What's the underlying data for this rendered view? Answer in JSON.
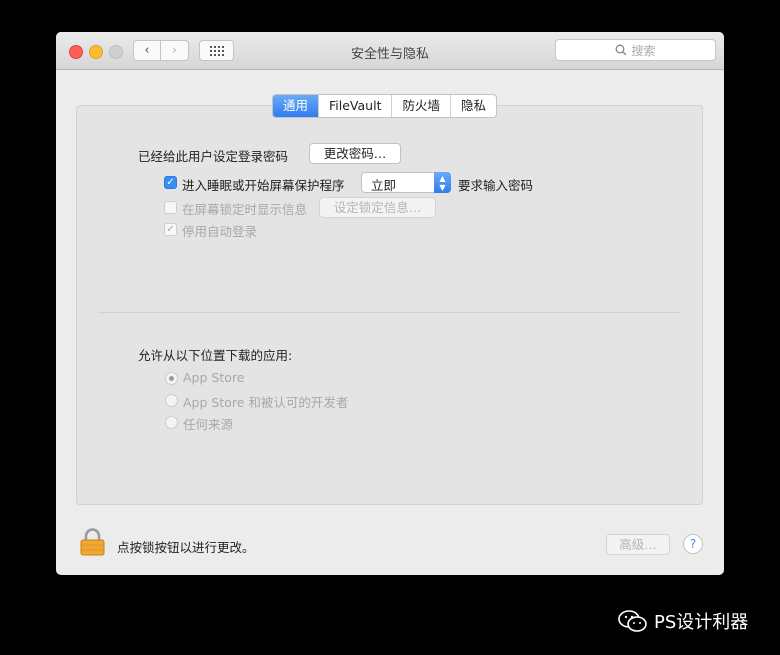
{
  "window": {
    "title": "安全性与隐私"
  },
  "search": {
    "placeholder": "搜索"
  },
  "tabs": [
    {
      "label": "通用",
      "active": true
    },
    {
      "label": "FileVault",
      "active": false
    },
    {
      "label": "防火墙",
      "active": false
    },
    {
      "label": "隐私",
      "active": false
    }
  ],
  "general": {
    "password_label": "已经给此用户设定登录密码",
    "change_password_button": "更改密码…",
    "require_password_label": "进入睡眠或开始屏幕保护程序",
    "require_password_delay": "立即",
    "require_password_suffix": "要求输入密码",
    "show_message_label": "在屏幕锁定时显示信息",
    "set_lock_message_button": "设定锁定信息…",
    "disable_autologin_label": "停用自动登录"
  },
  "downloads": {
    "heading": "允许从以下位置下载的应用:",
    "options": [
      "App Store",
      "App Store 和被认可的开发者",
      "任何来源"
    ]
  },
  "footer": {
    "lock_text": "点按锁按钮以进行更改。",
    "advanced_button": "高级…",
    "help_button": "?"
  },
  "watermark": {
    "text": "PS设计利器"
  },
  "colors": {
    "accent": "#3b8df6",
    "lock": "#f0a830"
  }
}
